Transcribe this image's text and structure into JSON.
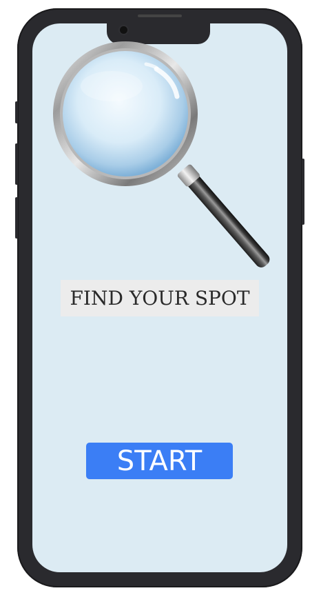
{
  "app": {
    "title": "FIND YOUR SPOT",
    "start_label": "START",
    "hero_icon": "magnifier-icon"
  },
  "colors": {
    "screen_bg": "#dcebf3",
    "title_bg": "#ececec",
    "button_bg": "#3b7ef5",
    "button_text": "#ffffff",
    "phone_frame": "#2a2a2e"
  }
}
